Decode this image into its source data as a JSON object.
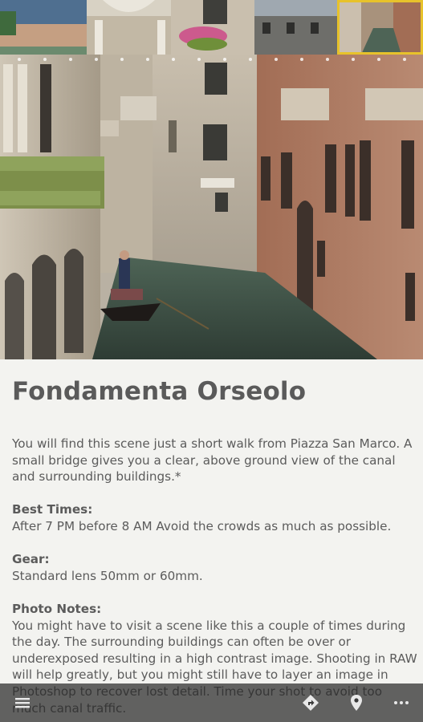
{
  "place": {
    "title": "Fondamenta Orseolo"
  },
  "description": {
    "intro": "You will find this scene just a short walk from Piazza San Marco. A small bridge gives you a clear, above ground view of the canal and surrounding buildings.*",
    "best_times_heading": "Best Times:",
    "best_times": "After 7 PM before 8 AM Avoid the crowds as much as possible.",
    "gear_heading": "Gear:",
    "gear": "Standard lens 50mm or 60mm.",
    "photo_notes_heading": "Photo Notes:",
    "photo_notes": "You might have to visit a scene like this a couple of times during the day. The surrounding buildings can often be over or underexposed resulting in a high contrast image. Shooting in RAW will help greatly, but you might still have to layer an image in Photoshop to recover lost detail. Time your shot to avoid too much canal traffic."
  },
  "bottom_bar": {
    "icons": [
      "menu-icon",
      "directions-icon",
      "map-pin-icon",
      "more-icon"
    ]
  },
  "colors": {
    "selected_thumb_border": "#e7c22b",
    "text": "#5b5b5b",
    "background": "#f3f3f0"
  }
}
